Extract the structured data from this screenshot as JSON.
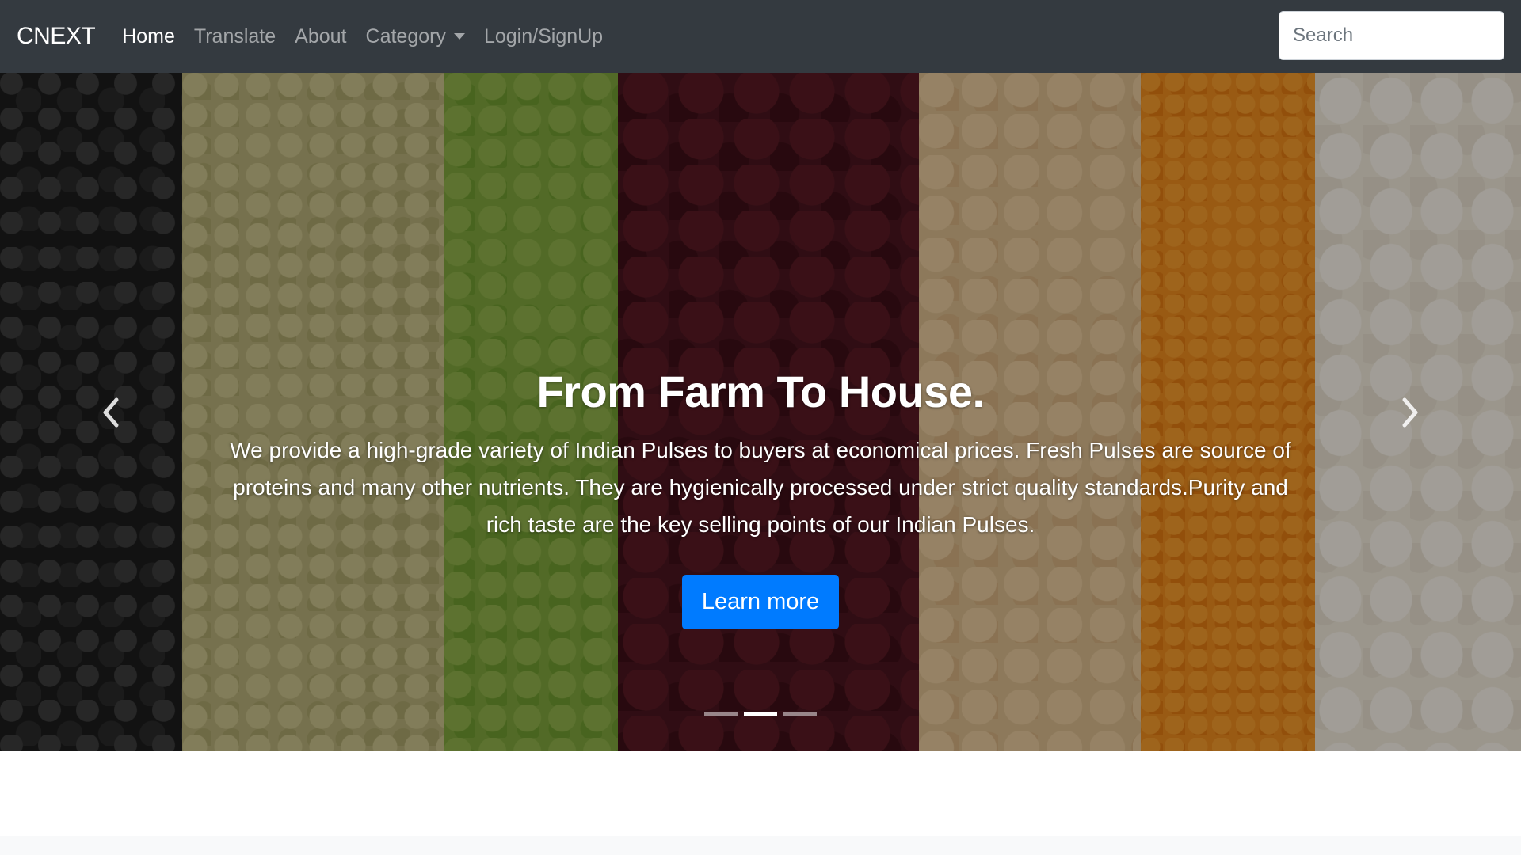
{
  "navbar": {
    "brand": "CNEXT",
    "links": [
      {
        "label": "Home",
        "active": true
      },
      {
        "label": "Translate",
        "active": false
      },
      {
        "label": "About",
        "active": false
      },
      {
        "label": "Category",
        "active": false,
        "dropdown": true
      },
      {
        "label": "Login/SignUp",
        "active": false
      }
    ],
    "search": {
      "placeholder": "Search",
      "value": ""
    }
  },
  "hero": {
    "title": "From Farm To House.",
    "description": "We provide a high-grade variety of Indian Pulses to buyers at economical prices. Fresh Pulses are source of proteins and many other nutrients. They are hygienically processed under strict quality standards.Purity and rich taste are the key selling points of our Indian Pulses.",
    "button_label": "Learn more",
    "indicators": {
      "count": 3,
      "active_index": 1
    },
    "icons": {
      "prev": "chevron-left-icon",
      "next": "chevron-right-icon"
    }
  },
  "colors": {
    "navbar_bg": "#343a40",
    "button_bg": "#007bff",
    "page_bg": "#ffffff"
  }
}
